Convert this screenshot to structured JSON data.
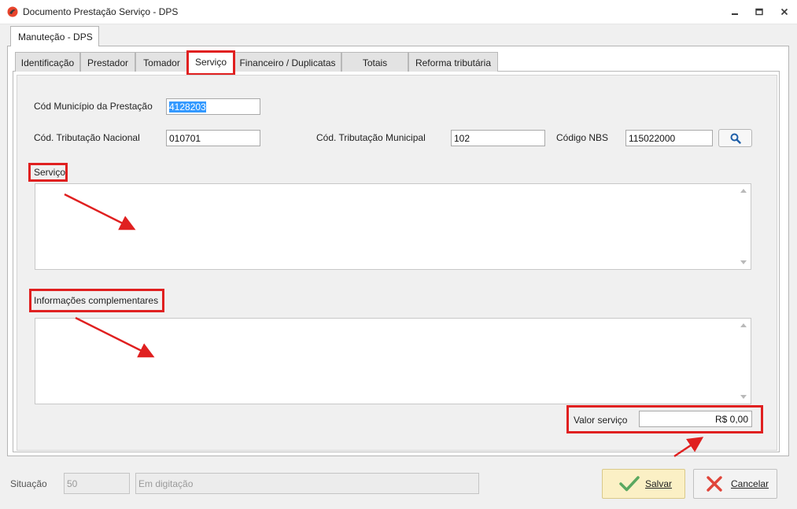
{
  "window": {
    "title": "Documento Prestação Serviço - DPS",
    "controls": [
      "minimize",
      "restore",
      "close"
    ]
  },
  "outer_tab": {
    "label": "Manutеção - DPS"
  },
  "tabs": [
    {
      "label": "Identificação"
    },
    {
      "label": "Prestador"
    },
    {
      "label": "Tomador"
    },
    {
      "label": "Serviço"
    },
    {
      "label": "Financeiro / Duplicatas"
    },
    {
      "label": "Totais"
    },
    {
      "label": "Reforma tributária"
    }
  ],
  "active_tab": "Serviço",
  "form": {
    "cod_municipio_label": "Cód Município da Prestação",
    "cod_municipio_value": "4128203",
    "cod_trib_nacional_label": "Cód. Tributação Nacional",
    "cod_trib_nacional_value": "010701",
    "cod_trib_municipal_label": "Cód. Tributação Municipal",
    "cod_trib_municipal_value": "102",
    "codigo_nbs_label": "Código NBS",
    "codigo_nbs_value": "115022000",
    "servico_label": "Serviço",
    "servico_value": "",
    "info_label": "Informações complementares",
    "info_value": "",
    "valor_label": "Valor serviço",
    "valor_value": "R$ 0,00"
  },
  "footer": {
    "situacao_label": "Situação",
    "situacao_code": "50",
    "situacao_text": "Em digitação",
    "save_label": "Salvar",
    "cancel_label": "Cancelar"
  },
  "colors": {
    "highlight": "#e02020",
    "save_bg": "#fbf0c5",
    "check": "#5aa860",
    "cancel_x": "#e0453a",
    "selection": "#3399ff"
  },
  "icons": [
    "app-logo-icon",
    "minimize-icon",
    "restore-icon",
    "close-icon",
    "search-icon",
    "check-icon",
    "x-icon"
  ]
}
